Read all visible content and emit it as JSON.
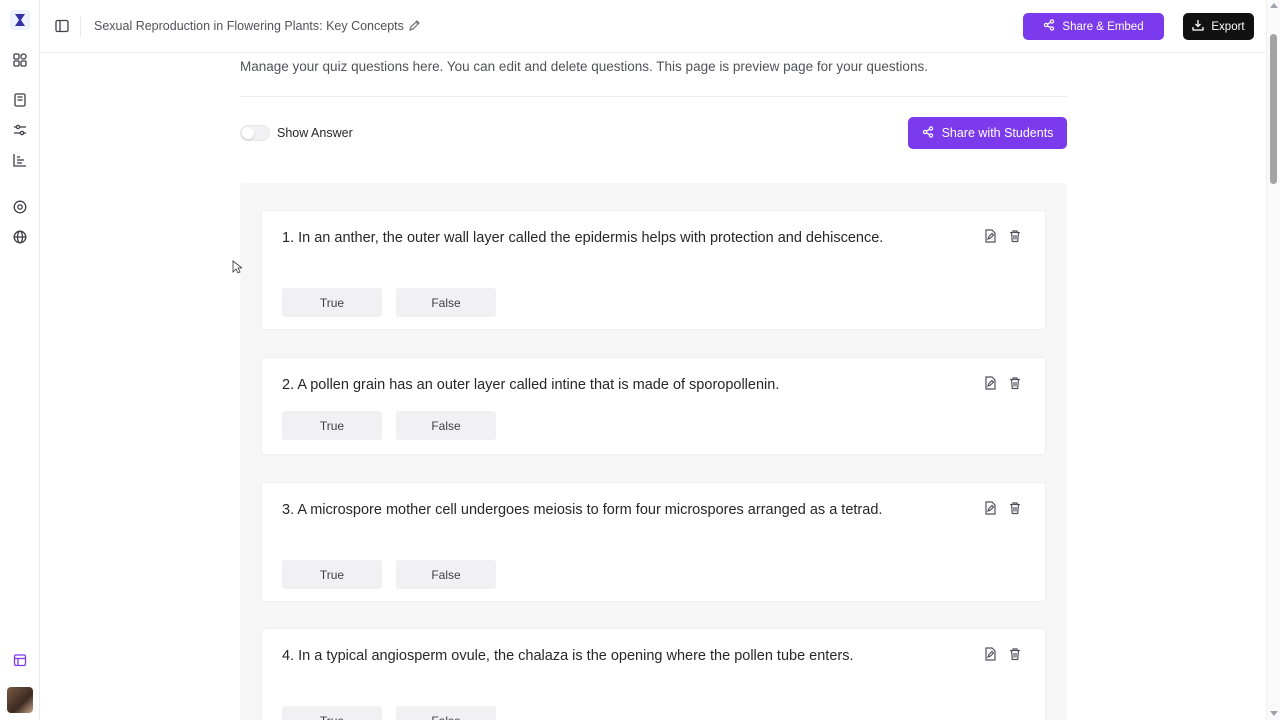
{
  "app": {
    "title": "Sexual Reproduction in Flowering Plants: Key Concepts",
    "accent_color": "#7c3aed"
  },
  "header": {
    "share_embed_label": "Share & Embed",
    "export_label": "Export"
  },
  "sidebar": {
    "icons": [
      "logo-icon",
      "apps-icon",
      "book-icon",
      "sliders-icon",
      "chart-icon",
      "chat-icon",
      "globe-icon",
      "calendar-icon",
      "avatar"
    ]
  },
  "main": {
    "description": "Manage your quiz questions here. You can edit and delete questions. This page is preview page for your questions.",
    "show_answer_label": "Show Answer",
    "show_answer_on": false,
    "share_students_label": "Share with Students"
  },
  "questions": [
    {
      "text": "1. In an anther, the outer wall layer called the epidermis helps with protection and dehiscence.",
      "options": [
        "True",
        "False"
      ]
    },
    {
      "text": "2. A pollen grain has an outer layer called intine that is made of sporopollenin.",
      "options": [
        "True",
        "False"
      ]
    },
    {
      "text": "3. A microspore mother cell undergoes meiosis to form four microspores arranged as a tetrad.",
      "options": [
        "True",
        "False"
      ]
    },
    {
      "text": "4. In a typical angiosperm ovule, the chalaza is the opening where the pollen tube enters.",
      "options": [
        "True",
        "False"
      ]
    }
  ]
}
